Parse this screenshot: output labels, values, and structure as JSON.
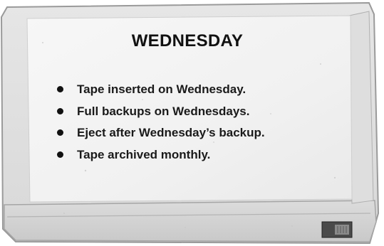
{
  "label": {
    "title": "WEDNESDAY",
    "items": [
      "Tape inserted on Wednesday.",
      "Full backups on Wednesdays.",
      "Eject after Wednesday’s backup.",
      "Tape archived monthly."
    ]
  },
  "colors": {
    "cartridge_body": "#ececec",
    "cartridge_edge": "#b9b9b9",
    "label_paper": "#f4f4f4",
    "text": "#111111"
  },
  "icons": [
    "write-protect-tab-icon"
  ]
}
